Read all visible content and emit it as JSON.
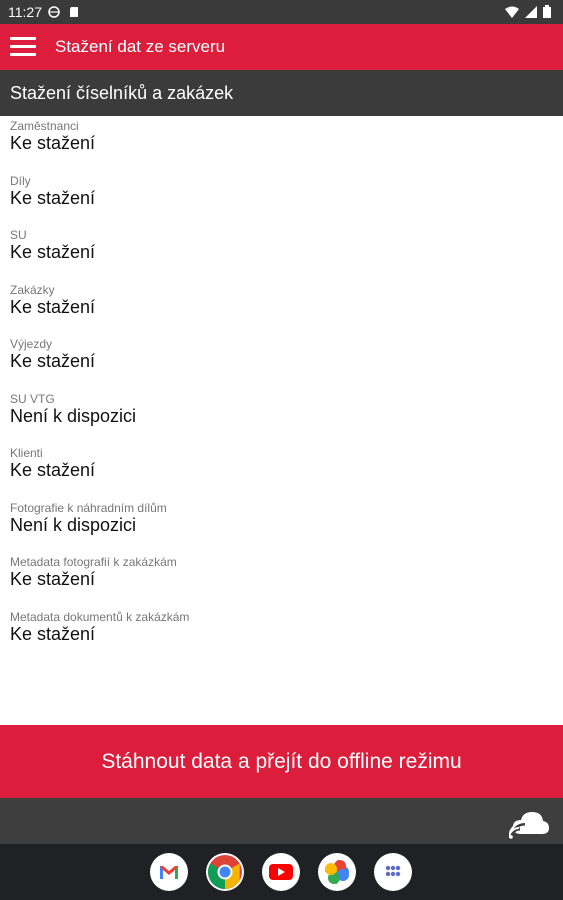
{
  "status_bar": {
    "time": "11:27"
  },
  "app_bar": {
    "title": "Stažení dat ze serveru"
  },
  "section": {
    "title": "Stažení číselníků a zakázek"
  },
  "items": [
    {
      "caption": "Zaměstnanci",
      "value": "Ke stažení"
    },
    {
      "caption": "Díly",
      "value": "Ke stažení"
    },
    {
      "caption": "SU",
      "value": "Ke stažení"
    },
    {
      "caption": "Zakázky",
      "value": "Ke stažení"
    },
    {
      "caption": "Výjezdy",
      "value": "Ke stažení"
    },
    {
      "caption": "SU VTG",
      "value": "Není k dispozici"
    },
    {
      "caption": "Klienti",
      "value": "Ke stažení"
    },
    {
      "caption": "Fotografie k náhradním dílům",
      "value": "Není k dispozici"
    },
    {
      "caption": "Metadata fotografií k zakázkám",
      "value": "Ke stažení"
    },
    {
      "caption": "Metadata dokumentů k zakázkám",
      "value": "Ke stažení"
    }
  ],
  "action_button": {
    "label": "Stáhnout data a přejít do offline režimu"
  },
  "dock": {
    "apps": [
      "gmail-icon",
      "chrome-icon",
      "youtube-icon",
      "photos-icon",
      "app-drawer-icon"
    ]
  },
  "colors": {
    "accent": "#dc1e3c",
    "header_dark": "#3b3b3b",
    "status_bar": "#3a3a3a",
    "dock": "#202124"
  }
}
